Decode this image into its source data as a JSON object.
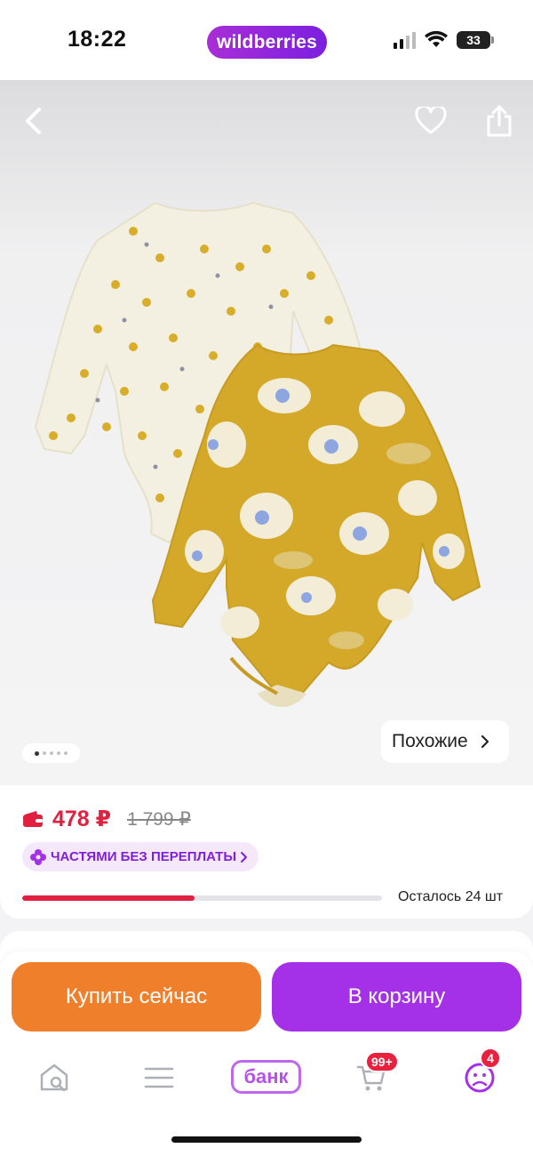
{
  "status_bar": {
    "time": "18:22",
    "app_badge": "wildberries",
    "battery": "33"
  },
  "gallery": {
    "similar_label": "Похожие",
    "page_indicator": {
      "total": 5,
      "active": 1
    }
  },
  "price": {
    "current": "478 ₽",
    "old": "1 799 ₽",
    "installment_label": "ЧАСТЯМИ БЕЗ ПЕРЕПЛАТЫ",
    "stock_label": "Осталось 24 шт",
    "stock_fill_fraction": 0.48
  },
  "actions": {
    "buy_now": "Купить сейчас",
    "add_to_cart": "В корзину"
  },
  "tabbar": {
    "bank_label": "банк",
    "cart_badge": "99+",
    "profile_badge": "4"
  },
  "colors": {
    "brand_purple": "#a431e8",
    "buy_orange": "#f07f2b",
    "price_red": "#e0203e",
    "bodysuit_yellow": "#d4a829",
    "bodysuit_cream": "#f4f0e1"
  }
}
